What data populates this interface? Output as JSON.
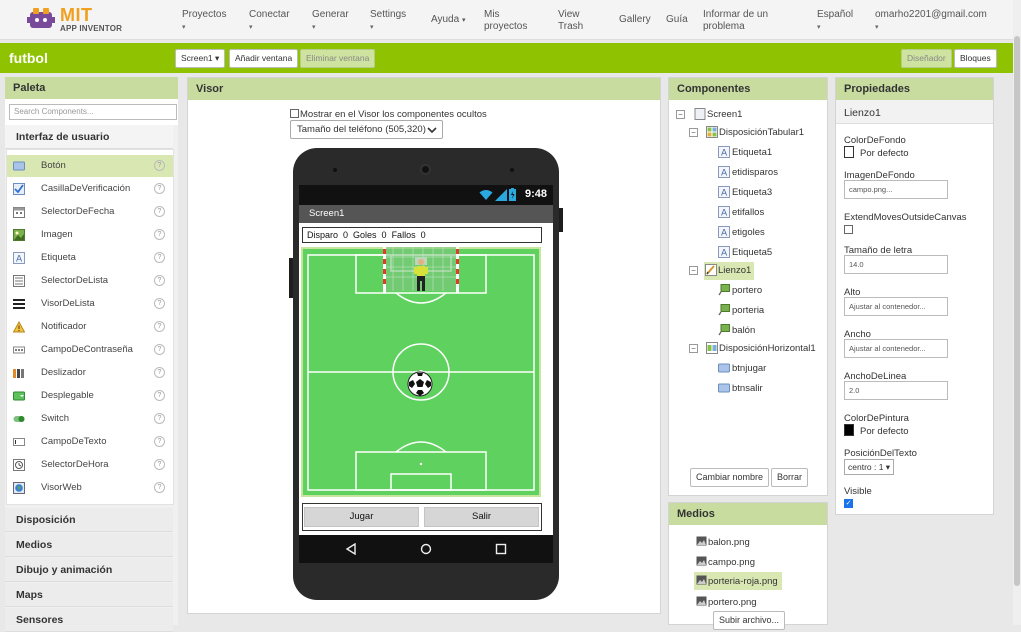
{
  "brand": {
    "name": "MIT",
    "sub": "APP INVENTOR"
  },
  "nav": {
    "proyectos": "Proyectos",
    "conectar": "Conectar",
    "generar": "Generar",
    "settings": "Settings",
    "ayuda": "Ayuda",
    "mis_proyectos_1": "Mis",
    "mis_proyectos_2": "proyectos",
    "view_trash_1": "View",
    "view_trash_2": "Trash",
    "gallery": "Gallery",
    "guia": "Guía",
    "informar_1": "Informar de un",
    "informar_2": "problema",
    "idioma": "Español",
    "user": "omarho2201@gmail.com",
    "caret": "▾"
  },
  "toolbar": {
    "project": "futbol",
    "screen_select": "Screen1 ▾",
    "add_screen": "Añadir ventana",
    "remove_screen": "Eliminar ventana",
    "designer": "Diseñador",
    "blocks": "Bloques"
  },
  "palette": {
    "title": "Paleta",
    "search_placeholder": "Search Components...",
    "ui_category": "Interfaz de usuario",
    "items": [
      "Botón",
      "CasillaDeVerificación",
      "SelectorDeFecha",
      "Imagen",
      "Etiqueta",
      "SelectorDeLista",
      "VisorDeLista",
      "Notificador",
      "CampoDeContraseña",
      "Deslizador",
      "Desplegable",
      "Switch",
      "CampoDeTexto",
      "SelectorDeHora",
      "VisorWeb"
    ],
    "help": "?",
    "categories": [
      "Disposición",
      "Medios",
      "Dibujo y animación",
      "Maps",
      "Sensores"
    ]
  },
  "viewer": {
    "title": "Visor",
    "show_hidden": "Mostrar en el Visor los componentes ocultos",
    "size_select": "Tamaño del teléfono (505,320)",
    "status_time": "9:48",
    "screen_title": "Screen1",
    "score": {
      "disparo_label": "Disparo",
      "disparo": "0",
      "goles_label": "Goles",
      "goles": "0",
      "fallos_label": "Fallos",
      "fallos": "0"
    },
    "btn_jugar": "Jugar",
    "btn_salir": "Salir"
  },
  "components": {
    "title": "Componentes",
    "tree": {
      "screen": "Screen1",
      "tabular": "DisposiciónTabular1",
      "etiqueta1": "Etiqueta1",
      "etidisparos": "etidisparos",
      "etiqueta3": "Etiqueta3",
      "etifallos": "etifallos",
      "etigoles": "etigoles",
      "etiqueta5": "Etiqueta5",
      "lienzo": "Lienzo1",
      "portero": "portero",
      "porteria": "porteria",
      "balon": "balón",
      "horizontal": "DisposiciónHorizontal1",
      "btnjugar": "btnjugar",
      "btnsalir": "btnsalir"
    },
    "rename": "Cambiar nombre",
    "delete": "Borrar",
    "minus": "−"
  },
  "media": {
    "title": "Medios",
    "items": [
      "balon.png",
      "campo.png",
      "porteria-roja.png",
      "portero.png"
    ],
    "upload": "Subir archivo..."
  },
  "properties": {
    "title": "Propiedades",
    "component": "Lienzo1",
    "bg_color_label": "ColorDeFondo",
    "bg_color_value": "Por defecto",
    "bg_image_label": "ImagenDeFondo",
    "bg_image_value": "campo.png...",
    "extend_label": "ExtendMovesOutsideCanvas",
    "font_size_label": "Tamaño de letra",
    "font_size_value": "14.0",
    "height_label": "Alto",
    "height_value": "Ajustar al contenedor...",
    "width_label": "Ancho",
    "width_value": "Ajustar al contenedor...",
    "line_width_label": "AnchoDeLinea",
    "line_width_value": "2.0",
    "paint_color_label": "ColorDePintura",
    "paint_color_value": "Por defecto",
    "text_pos_label": "PosiciónDelTexto",
    "text_pos_value": "centro : 1 ▾",
    "visible_label": "Visible",
    "check": "✓"
  },
  "colors": {
    "accent_green": "#8fc200",
    "panel_head": "#c8dca0",
    "selected": "#d9e8b3",
    "field": "#5fd15f"
  }
}
